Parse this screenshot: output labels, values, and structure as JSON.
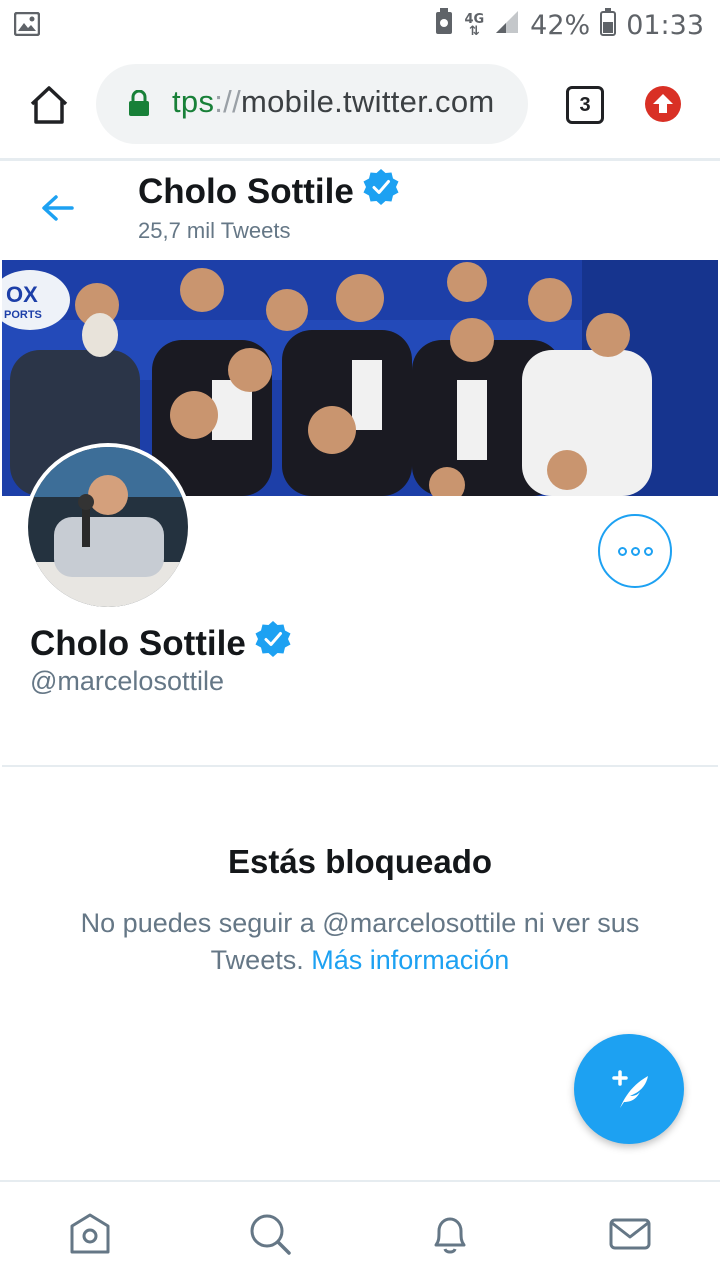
{
  "status_bar": {
    "network": "4G",
    "battery": "42%",
    "time": "01:33"
  },
  "browser": {
    "url_scheme": "tps",
    "url_sep": "://",
    "url_host": "mobile.twitter.com",
    "tab_count": "3"
  },
  "header": {
    "name": "Cholo Sottile",
    "tweets": "25,7 mil Tweets"
  },
  "banner": {
    "logo_text_1": "OX",
    "logo_text_2": "PORTS"
  },
  "profile": {
    "name": "Cholo Sottile",
    "handle": "@marcelosottile"
  },
  "blocked": {
    "title": "Estás bloqueado",
    "text": "No puedes seguir a @marcelosottile ni ver sus Tweets.",
    "link": "Más información"
  },
  "colors": {
    "twitter_blue": "#1da1f2",
    "secure_green": "#188038",
    "update_red": "#d93025"
  },
  "bottom_nav": [
    {
      "name": "home-icon"
    },
    {
      "name": "search-icon"
    },
    {
      "name": "notifications-icon"
    },
    {
      "name": "messages-icon"
    }
  ]
}
